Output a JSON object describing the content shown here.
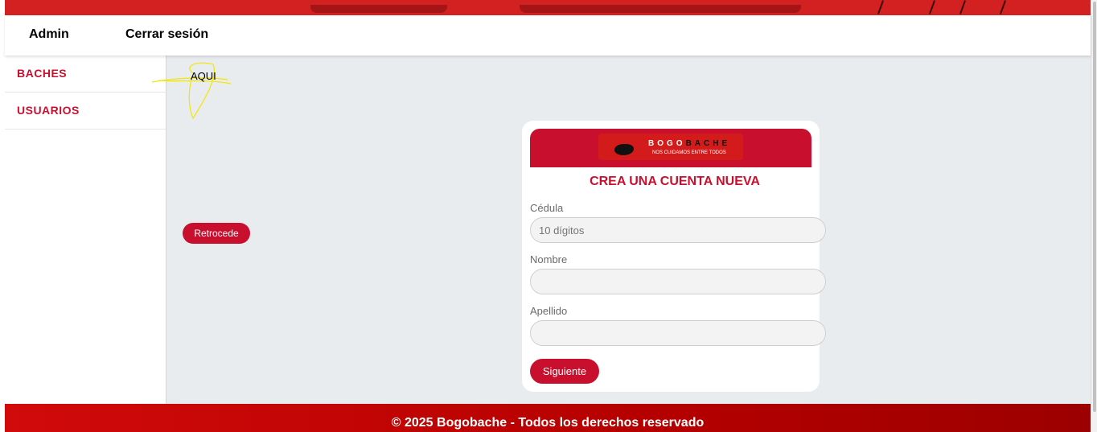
{
  "nav": {
    "admin": "Admin",
    "logout": "Cerrar sesión"
  },
  "sidebar": {
    "items": [
      {
        "label": "BACHES"
      },
      {
        "label": "USUARIOS"
      }
    ]
  },
  "main": {
    "annotation": "AQUI",
    "back_button": "Retrocede"
  },
  "form": {
    "logo": {
      "brand_light": "BOGO",
      "brand_dark": "BACHE",
      "slogan": "NOS CUIDAMOS ENTRE TODOS"
    },
    "title": "CREA UNA CUENTA NUEVA",
    "fields": [
      {
        "label": "Cédula",
        "placeholder": "10 dígitos",
        "value": ""
      },
      {
        "label": "Nombre",
        "placeholder": "",
        "value": ""
      },
      {
        "label": "Apellido",
        "placeholder": "",
        "value": ""
      }
    ],
    "submit": "Siguiente"
  },
  "footer": {
    "text": "© 2025 Bogobache - Todos los derechos reservado"
  },
  "colors": {
    "brand_red": "#c8102e",
    "banner_red": "#d32020",
    "background": "#e9ecef"
  }
}
